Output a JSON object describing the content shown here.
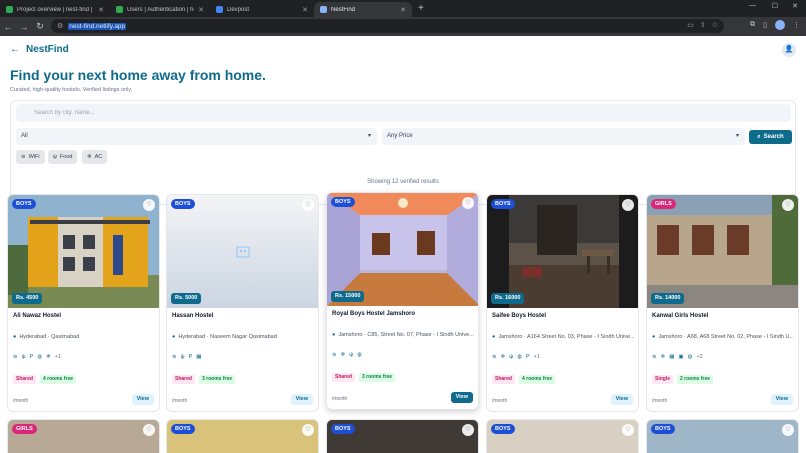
{
  "browser": {
    "tabs": [
      {
        "title": "Project overview | nest-find | Fir",
        "color": "#34a853"
      },
      {
        "title": "Users | Authentication | hostel-f",
        "color": "#34a853"
      },
      {
        "title": "Devpost",
        "color": "#4285f4"
      },
      {
        "title": "NestFind",
        "color": "#8ab4f8"
      }
    ],
    "url": "nest-find.netlify.app"
  },
  "app": {
    "brand": "NestFind",
    "hero_title": "Find your next home away from home.",
    "hero_sub": "Curated, high-quality hostels. Verified listings only.",
    "search": {
      "placeholder": "Search by city, name...",
      "type_value": "All",
      "price_value": "Any Price",
      "button": "Search"
    },
    "filters": [
      "WiFi",
      "Food",
      "AC"
    ],
    "results_text": "Showing 12 verified results"
  },
  "listings": [
    {
      "badge": "BOYS",
      "price": "Rs. 4500",
      "name": "Ali Nawaz Hostel",
      "location": "Hyderabad · Qasimabad",
      "amenities_more": "+1",
      "type": "Shared",
      "rooms": "4 rooms free",
      "per": "/month",
      "view": "View"
    },
    {
      "badge": "BOYS",
      "price": "Rs. 5000",
      "name": "Hassan Hostel",
      "location": "Hyderabad · Naseem Nagar Qasimabad",
      "amenities_more": "",
      "type": "Shared",
      "rooms": "3 rooms free",
      "per": "/month",
      "view": "View"
    },
    {
      "badge": "BOYS",
      "price": "Rs. 15000",
      "name": "Royal Boys Hostel Jamshoro",
      "location": "Jamshoro · C85, Street No. 07, Phase - I Sindh Unive...",
      "amenities_more": "",
      "type": "Shared",
      "rooms": "3 rooms free",
      "per": "/month",
      "view": "View"
    },
    {
      "badge": "BOYS",
      "price": "Rs. 16000",
      "name": "Saifee Boys Hostel",
      "location": "Jamshoro · A164 Street No. 03, Phase - I Sindh Unive...",
      "amenities_more": "+1",
      "type": "Shared",
      "rooms": "4 rooms free",
      "per": "/month",
      "view": "View"
    },
    {
      "badge": "GIRLS",
      "price": "Rs. 14000",
      "name": "Kanwal Girls Hostel",
      "location": "Jamshoro · A68, A68 Street No. 02, Phase - I Sindh U...",
      "amenities_more": "+2",
      "type": "Single",
      "rooms": "2 rooms free",
      "per": "/month",
      "view": "View"
    }
  ],
  "row2_badges": [
    "GIRLS",
    "BOYS",
    "BOYS",
    "BOYS",
    "BOYS"
  ],
  "colors": {
    "brand": "#0e6b8c",
    "boys_badge": "#1d4ed8",
    "girls_badge": "#db2777"
  }
}
